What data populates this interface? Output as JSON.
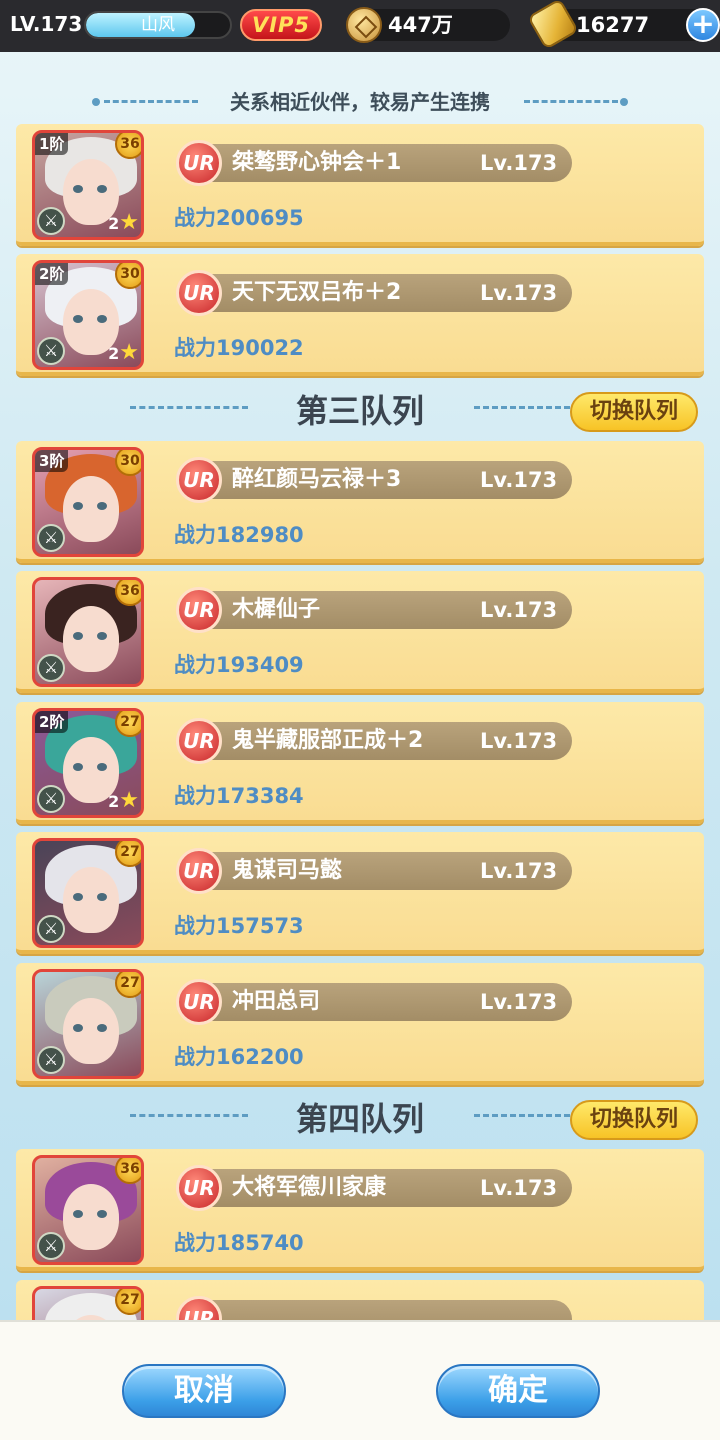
{
  "topbar": {
    "level": "LV.173",
    "player_name": "山风",
    "exp_fraction": 0.76,
    "vip": "VIP5",
    "coins": "447万",
    "gold": "16277",
    "plus": "+"
  },
  "subtitle": "关系相近伙伴，较易产生连携",
  "sections": {
    "third": "第三队列",
    "fourth": "第四队列",
    "switch_label": "切换队列"
  },
  "heroes": [
    {
      "name": "桀骜野心钟会＋1",
      "level": "Lv.173",
      "power": "战力200695",
      "stage": "1阶",
      "badge": "36",
      "stars": "2",
      "rarity": "UR",
      "hair": "#e8e6e4",
      "bg": "#c7a6a0"
    },
    {
      "name": "天下无双吕布＋2",
      "level": "Lv.173",
      "power": "战力190022",
      "stage": "2阶",
      "badge": "30",
      "stars": "2",
      "rarity": "UR",
      "hair": "#eef0f4",
      "bg": "#d7c3d0"
    },
    {
      "name": "醉红颜马云禄＋3",
      "level": "Lv.173",
      "power": "战力182980",
      "stage": "3阶",
      "badge": "30",
      "stars": "",
      "rarity": "UR",
      "hair": "#d8652e",
      "bg": "#e6a1b2"
    },
    {
      "name": "木樨仙子",
      "level": "Lv.173",
      "power": "战力193409",
      "stage": "",
      "badge": "36",
      "stars": "",
      "rarity": "UR",
      "hair": "#3a2320",
      "bg": "#e6b5b8"
    },
    {
      "name": "鬼半藏服部正成＋2",
      "level": "Lv.173",
      "power": "战力173384",
      "stage": "2阶",
      "badge": "27",
      "stars": "2",
      "rarity": "UR",
      "hair": "#3aa69a",
      "bg": "#8a5a9a"
    },
    {
      "name": "鬼谋司马懿",
      "level": "Lv.173",
      "power": "战力157573",
      "stage": "",
      "badge": "27",
      "stars": "",
      "rarity": "UR",
      "hair": "#e4e4ea",
      "bg": "#4a4458"
    },
    {
      "name": "冲田总司",
      "level": "Lv.173",
      "power": "战力162200",
      "stage": "",
      "badge": "27",
      "stars": "",
      "rarity": "UR",
      "hair": "#c9cbbd",
      "bg": "#b9d4d8"
    },
    {
      "name": "大将军德川家康",
      "level": "Lv.173",
      "power": "战力185740",
      "stage": "",
      "badge": "36",
      "stars": "",
      "rarity": "UR",
      "hair": "#9a4a9a",
      "bg": "#e0b0a0"
    },
    {
      "name": "",
      "level": "",
      "power": "",
      "stage": "",
      "badge": "27",
      "stars": "",
      "rarity": "UR",
      "hair": "#eeeeee",
      "bg": "#d8d8e4"
    }
  ],
  "footer": {
    "cancel": "取消",
    "confirm": "确定"
  },
  "colors": {
    "card_bg": "#fde9a8",
    "accent_blue": "#3b9fe8",
    "power_text": "#4e8cc4",
    "vip_red": "#c4141a"
  },
  "icons": {
    "coin": "coin-icon",
    "gold": "gold-ingot-icon",
    "plus": "plus-icon",
    "type": "class-icon",
    "star": "star-icon"
  }
}
